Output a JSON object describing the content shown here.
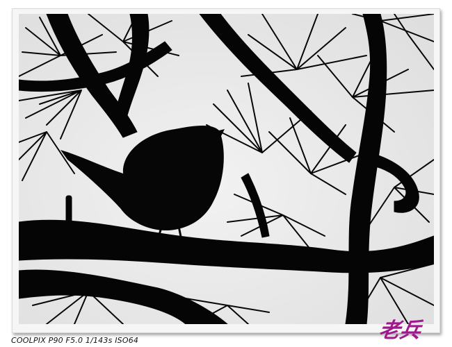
{
  "photo": {
    "subject_icon": "bird-silhouette",
    "sky_color": "#eaeaea",
    "silhouette_color": "#050505"
  },
  "caption": {
    "exif_text": "COOLPIX P90 F5.0 1/143s ISO64"
  },
  "signature": {
    "text": "老兵",
    "color": "#a0188c"
  },
  "frame": {
    "background": "#ffffff",
    "border_color": "#d8d8d8"
  }
}
